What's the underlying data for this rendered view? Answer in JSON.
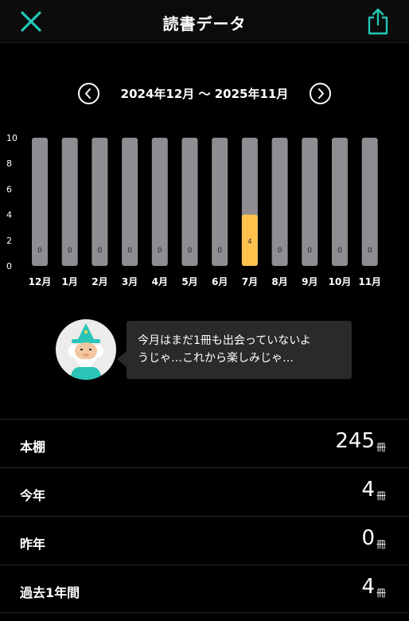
{
  "header": {
    "title": "読書データ",
    "close_icon": "close-icon",
    "share_icon": "share-icon",
    "accent": "#23c7b6"
  },
  "range": {
    "text": "2024年12月 〜 2025年11月",
    "prev_icon": "chevron-left-icon",
    "next_icon": "chevron-right-icon"
  },
  "chart_data": {
    "type": "bar",
    "categories": [
      "12月",
      "1月",
      "2月",
      "3月",
      "4月",
      "5月",
      "6月",
      "7月",
      "8月",
      "9月",
      "10月",
      "11月"
    ],
    "values": [
      0,
      0,
      0,
      0,
      0,
      0,
      0,
      4,
      0,
      0,
      0,
      0
    ],
    "yticks": [
      0,
      2,
      4,
      6,
      8,
      10
    ],
    "ylim": [
      0,
      10
    ],
    "bar_color": "#8e8d92",
    "highlight_color": "#ffc34d",
    "grid": false
  },
  "speech": {
    "text_line1": "今月はまだ1冊も出会っていないよ",
    "text_line2": "うじゃ…これから楽しみじゃ…"
  },
  "stats": [
    {
      "label": "本棚",
      "value": "245",
      "unit": "冊"
    },
    {
      "label": "今年",
      "value": "4",
      "unit": "冊"
    },
    {
      "label": "昨年",
      "value": "0",
      "unit": "冊"
    },
    {
      "label": "過去1年間",
      "value": "4",
      "unit": "冊"
    }
  ]
}
